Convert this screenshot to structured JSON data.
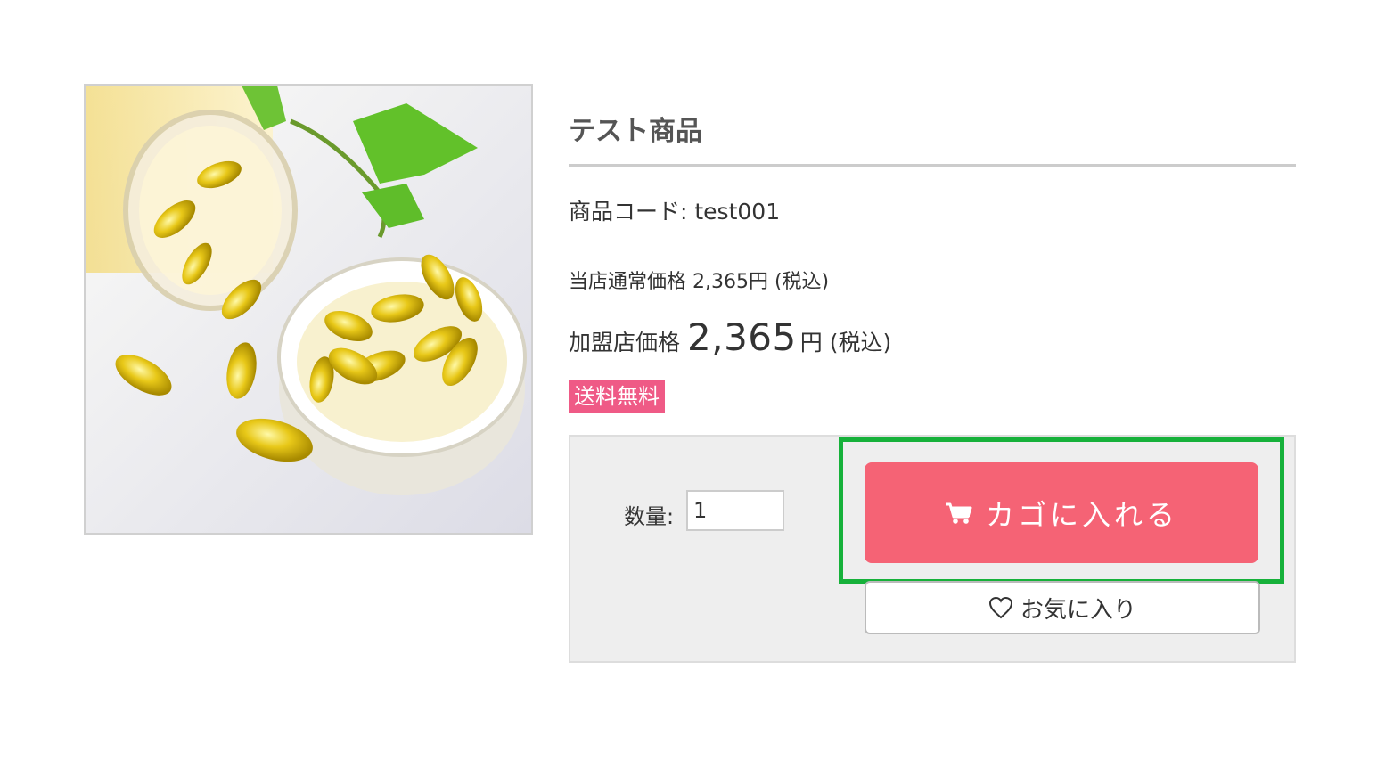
{
  "product": {
    "title": "テスト商品",
    "code_label": "商品コード: test001",
    "regular_price_label": "当店通常価格 2,365円 (税込)",
    "member_price_prefix": "加盟店価格",
    "member_price_amount": "2,365",
    "member_price_unit": "円",
    "member_price_tax": "(税込)",
    "badge": "送料無料"
  },
  "cart": {
    "quantity_label": "数量:",
    "quantity_value": "1",
    "add_to_cart_label": "カゴに入れる",
    "favorite_label": "お気に入り"
  },
  "colors": {
    "accent": "#f56375",
    "badge": "#ef5a86",
    "highlight": "#16b13a"
  },
  "icons": {
    "cart": "cart-icon",
    "favorite": "heart-icon"
  }
}
